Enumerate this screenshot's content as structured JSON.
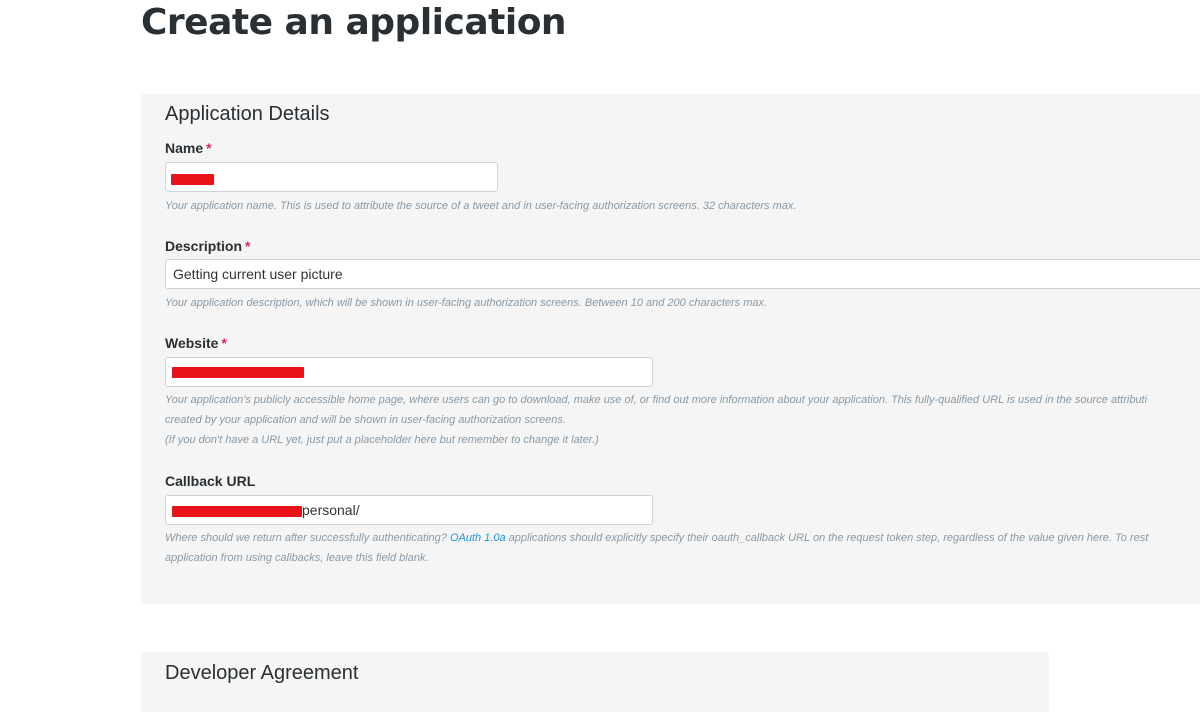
{
  "page": {
    "title": "Create an application"
  },
  "details": {
    "heading": "Application Details",
    "required_mark": "*",
    "name": {
      "label": "Name",
      "value": "",
      "help": "Your application name. This is used to attribute the source of a tweet and in user-facing authorization screens. 32 characters max."
    },
    "description": {
      "label": "Description",
      "value": "Getting current user picture",
      "help": "Your application description, which will be shown in user-facing authorization screens. Between 10 and 200 characters max."
    },
    "website": {
      "label": "Website",
      "value": "",
      "help_line1": "Your application's publicly accessible home page, where users can go to download, make use of, or find out more information about your application. This fully-qualified URL is used in the source attributi",
      "help_line2": "created by your application and will be shown in user-facing authorization screens.",
      "help_line3": "(If you don't have a URL yet, just put a placeholder here but remember to change it later.)"
    },
    "callback": {
      "label": "Callback URL",
      "value_visible_suffix": "personal/",
      "help_pre": "Where should we return after successfully authenticating?",
      "help_link": "OAuth 1.0a",
      "help_post": "applications should explicitly specify their oauth_callback URL on the request token step, regardless of the value given here. To rest",
      "help_line2": "application from using callbacks, leave this field blank."
    }
  },
  "agreement": {
    "heading": "Developer Agreement"
  },
  "colors": {
    "required": "#e0245e",
    "link": "#1b95e0",
    "redaction": "#e8141a",
    "panel_bg": "#f5f5f5"
  }
}
